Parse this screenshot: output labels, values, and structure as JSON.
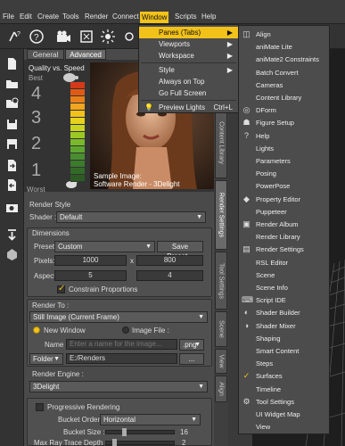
{
  "menubar": [
    "File",
    "Edit",
    "Create",
    "Tools",
    "Render",
    "Connect",
    "Window",
    "Scripts",
    "Help"
  ],
  "toolbar_icons": [
    "pose-tool-icon",
    "help-icon",
    "camera-icon",
    "render-icon",
    "spotlight-icon",
    "sun-icon",
    "grid-icon",
    "tool-icon"
  ],
  "left_icons": [
    "new-file-icon",
    "open-folder-icon",
    "open-recent-icon",
    "save-icon",
    "save-as-icon",
    "import-icon",
    "export-icon",
    "render-settings-icon",
    "down-arrow-icon",
    "figure-icon"
  ],
  "panel": {
    "tabs": [
      "General",
      "Advanced"
    ],
    "quality_speed_label": "Quality vs. Speed",
    "best_label": "Best",
    "worst_label": "Worst",
    "quality_numbers": [
      "4",
      "3",
      "2",
      "1"
    ],
    "sample_caption_1": "Sample Image:",
    "sample_caption_2": "Software Render - 3Delight",
    "vertical_tabs": [
      "Content Library",
      "Render Settings",
      "Tool Settings",
      "Scene",
      "View",
      "Align"
    ]
  },
  "render_style": {
    "label": "Render Style",
    "shader_label": "Shader :",
    "shader_value": "Default"
  },
  "dimensions": {
    "label": "Dimensions",
    "preset_label": "Preset:",
    "preset_value": "Custom",
    "save_preset_button": "Save Preset...",
    "pixels_label": "Pixels:",
    "pixels_w": "1000",
    "x_sep": "x",
    "pixels_h": "800",
    "aspect_label": "Aspect:",
    "aspect_w": "5",
    "aspect_h": "4",
    "constrain_label": "Constrain Proportions",
    "constrain_checked": true
  },
  "render_to": {
    "label": "Render To :",
    "mode_value": "Still Image (Current Frame)",
    "new_window_label": "New Window",
    "image_file_label": "Image File :",
    "name_label": "Name :",
    "name_placeholder": "Enter a name for the image...",
    "ext_value": ".png",
    "folder_value": "Folder",
    "folder_path": "E:/Renders",
    "browse_button": "..."
  },
  "render_engine": {
    "label": "Render Engine :",
    "engine_value": "3Delight",
    "progressive_label": "Progressive Rendering",
    "bucket_order_label": "Bucket Order :",
    "bucket_order_value": "Horizontal",
    "bucket_size_label": "Bucket Size :",
    "bucket_size_value": "16",
    "bucket_size_fraction": 0.25,
    "max_ray_label": "Max Ray Trace Depth :",
    "max_ray_value": "2",
    "max_ray_fraction": 0.1
  },
  "window_menu": {
    "items": [
      {
        "label": "Panes (Tabs)",
        "submenu": true,
        "highlight": true
      },
      {
        "label": "Viewports",
        "submenu": true
      },
      {
        "label": "Workspace",
        "submenu": true
      },
      {
        "label": "Style",
        "submenu": true
      },
      {
        "label": "Always on Top"
      },
      {
        "label": "Go Full Screen"
      },
      {
        "label": "Preview Lights",
        "shortcut": "Ctrl+L"
      }
    ]
  },
  "panes_menu": [
    {
      "label": "Align",
      "icon": "align-icon"
    },
    {
      "label": "aniMate Lite",
      "icon": "none"
    },
    {
      "label": "aniMate2 Constraints",
      "icon": "none"
    },
    {
      "label": "Batch Convert",
      "icon": "none"
    },
    {
      "label": "Cameras",
      "icon": "none"
    },
    {
      "label": "Content Library",
      "icon": "none"
    },
    {
      "label": "DForm",
      "icon": "dform-icon"
    },
    {
      "label": "Figure Setup",
      "icon": "figure-setup-icon"
    },
    {
      "label": "Help",
      "icon": "help-icon"
    },
    {
      "label": "Lights",
      "icon": "none"
    },
    {
      "label": "Parameters",
      "icon": "none"
    },
    {
      "label": "Posing",
      "icon": "none"
    },
    {
      "label": "PowerPose",
      "icon": "none"
    },
    {
      "label": "Property Editor",
      "icon": "property-editor-icon"
    },
    {
      "label": "Puppeteer",
      "icon": "none"
    },
    {
      "label": "Render Album",
      "icon": "render-album-icon"
    },
    {
      "label": "Render Library",
      "icon": "none"
    },
    {
      "label": "Render Settings",
      "icon": "render-settings-icon"
    },
    {
      "label": "RSL Editor",
      "icon": "none"
    },
    {
      "label": "Scene",
      "icon": "none"
    },
    {
      "label": "Scene Info",
      "icon": "none"
    },
    {
      "label": "Script IDE",
      "icon": "script-ide-icon"
    },
    {
      "label": "Shader Builder",
      "icon": "shader-builder-icon"
    },
    {
      "label": "Shader Mixer",
      "icon": "shader-mixer-icon"
    },
    {
      "label": "Shaping",
      "icon": "none"
    },
    {
      "label": "Smart Content",
      "icon": "none"
    },
    {
      "label": "Steps",
      "icon": "none"
    },
    {
      "label": "Surfaces",
      "icon": "checkmark-icon"
    },
    {
      "label": "Timeline",
      "icon": "none"
    },
    {
      "label": "Tool Settings",
      "icon": "tool-settings-icon"
    },
    {
      "label": "UI Widget Map",
      "icon": "none"
    },
    {
      "label": "View",
      "icon": "none"
    }
  ],
  "colors": {
    "accent": "#f2c21a",
    "meter": [
      "#d23a1a",
      "#e05a14",
      "#e8801a",
      "#f2a51e",
      "#f2c21a",
      "#e6d21e",
      "#c8d420",
      "#9cc824",
      "#7ab82a",
      "#5ea62e",
      "#4a8e30",
      "#3c7a2c",
      "#336a28",
      "#2c5c24"
    ]
  }
}
